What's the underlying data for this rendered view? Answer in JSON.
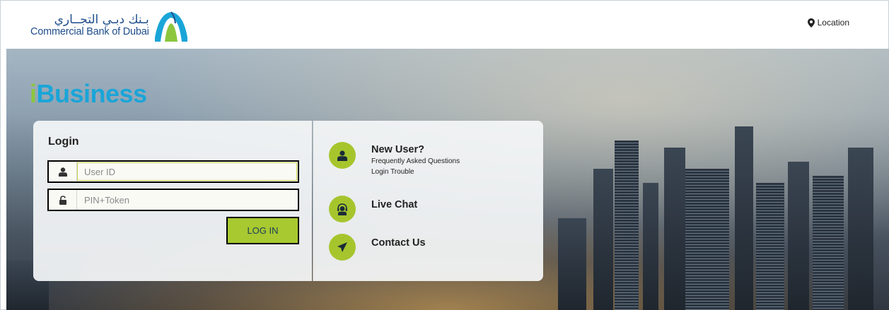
{
  "header": {
    "logo": {
      "arabic": "بـنك دبـي التجــاري",
      "english": "Commercial Bank of Dubai"
    },
    "location_label": "Location"
  },
  "hero": {
    "brand": {
      "prefix": "i",
      "suffix": "Business"
    }
  },
  "login": {
    "title": "Login",
    "user_id_placeholder": "User ID",
    "pin_placeholder": "PIN+Token",
    "button_label": "LOG IN"
  },
  "info": {
    "new_user": {
      "title": "New User?",
      "links": [
        "Frequently Asked Questions",
        "Login Trouble"
      ]
    },
    "live_chat": {
      "title": "Live Chat"
    },
    "contact_us": {
      "title": "Contact Us"
    }
  },
  "colors": {
    "accent_green": "#a6c52d",
    "brand_blue": "#1aa5d8",
    "logo_blue": "#1f4e8c"
  }
}
